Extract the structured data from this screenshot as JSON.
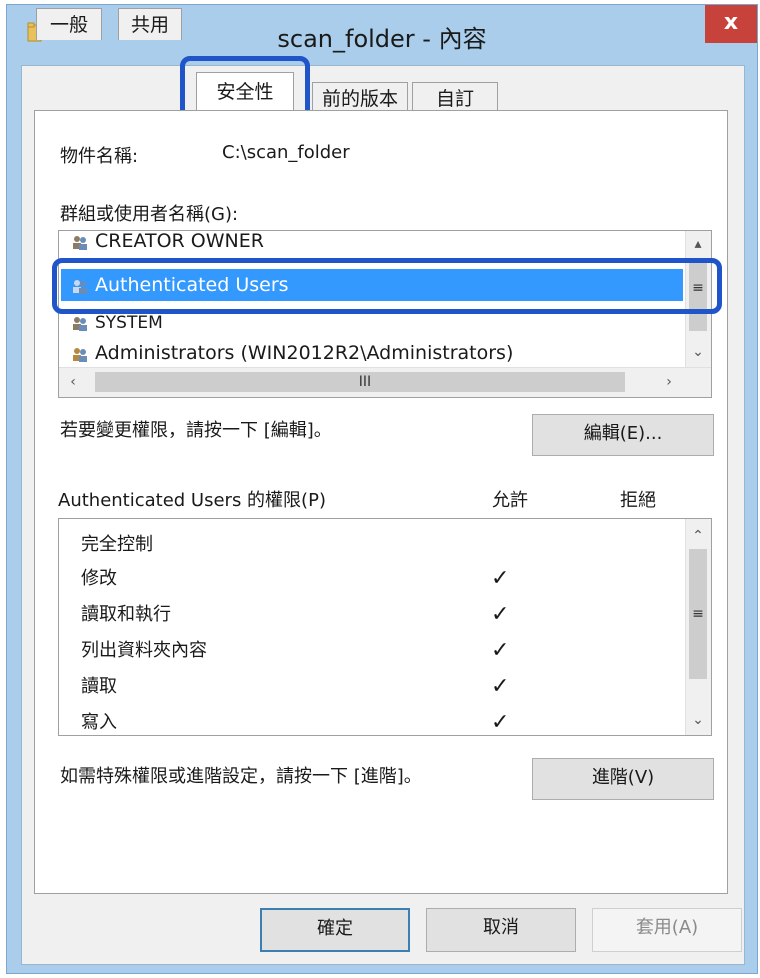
{
  "window": {
    "title": "scan_folder - 內容",
    "close_glyph": "x"
  },
  "tabs": [
    {
      "label": "一般"
    },
    {
      "label": "共用"
    },
    {
      "label": "安全性",
      "active": true
    },
    {
      "label": "前的版本"
    },
    {
      "label": "自訂"
    }
  ],
  "object": {
    "label": "物件名稱:",
    "value": "C:\\scan_folder"
  },
  "groups": {
    "label": "群組或使用者名稱(G):",
    "items": [
      {
        "label": "CREATOR OWNER"
      },
      {
        "label": "Authenticated Users",
        "selected": true
      },
      {
        "label": "SYSTEM"
      },
      {
        "label": "Administrators (WIN2012R2\\Administrators)"
      }
    ],
    "hscroll_thumb_glyph": "III",
    "vscroll_thumb_glyph": "≡"
  },
  "edit": {
    "hint": "若要變更權限，請按一下 [編輯]。",
    "button_label": "編輯(E)..."
  },
  "permissions": {
    "label": "Authenticated Users 的權限(P)",
    "allow_header": "允許",
    "deny_header": "拒絕",
    "rows": [
      {
        "name": "完全控制",
        "allow": false
      },
      {
        "name": "修改",
        "allow": true
      },
      {
        "name": "讀取和執行",
        "allow": true
      },
      {
        "name": "列出資料夾內容",
        "allow": true
      },
      {
        "name": "讀取",
        "allow": true
      },
      {
        "name": "寫入",
        "allow": true
      }
    ],
    "check_glyph": "✓",
    "vscroll_thumb_glyph": "≡"
  },
  "advanced": {
    "hint": "如需特殊權限或進階設定，請按一下 [進階]。",
    "button_label": "進階(V)"
  },
  "footer": {
    "ok_label": "確定",
    "cancel_label": "取消",
    "apply_label": "套用(A)"
  },
  "colors": {
    "selection": "#3399ff",
    "highlight_outline": "#1f55c9",
    "close_button": "#c7423a",
    "frame": "#a9cdea"
  },
  "icons": {
    "window": "folder-icon",
    "users": "users-icon",
    "scroll_up": "chevron-up-icon",
    "scroll_down": "chevron-down-icon",
    "scroll_left": "chevron-left-icon",
    "scroll_right": "chevron-right-icon"
  }
}
